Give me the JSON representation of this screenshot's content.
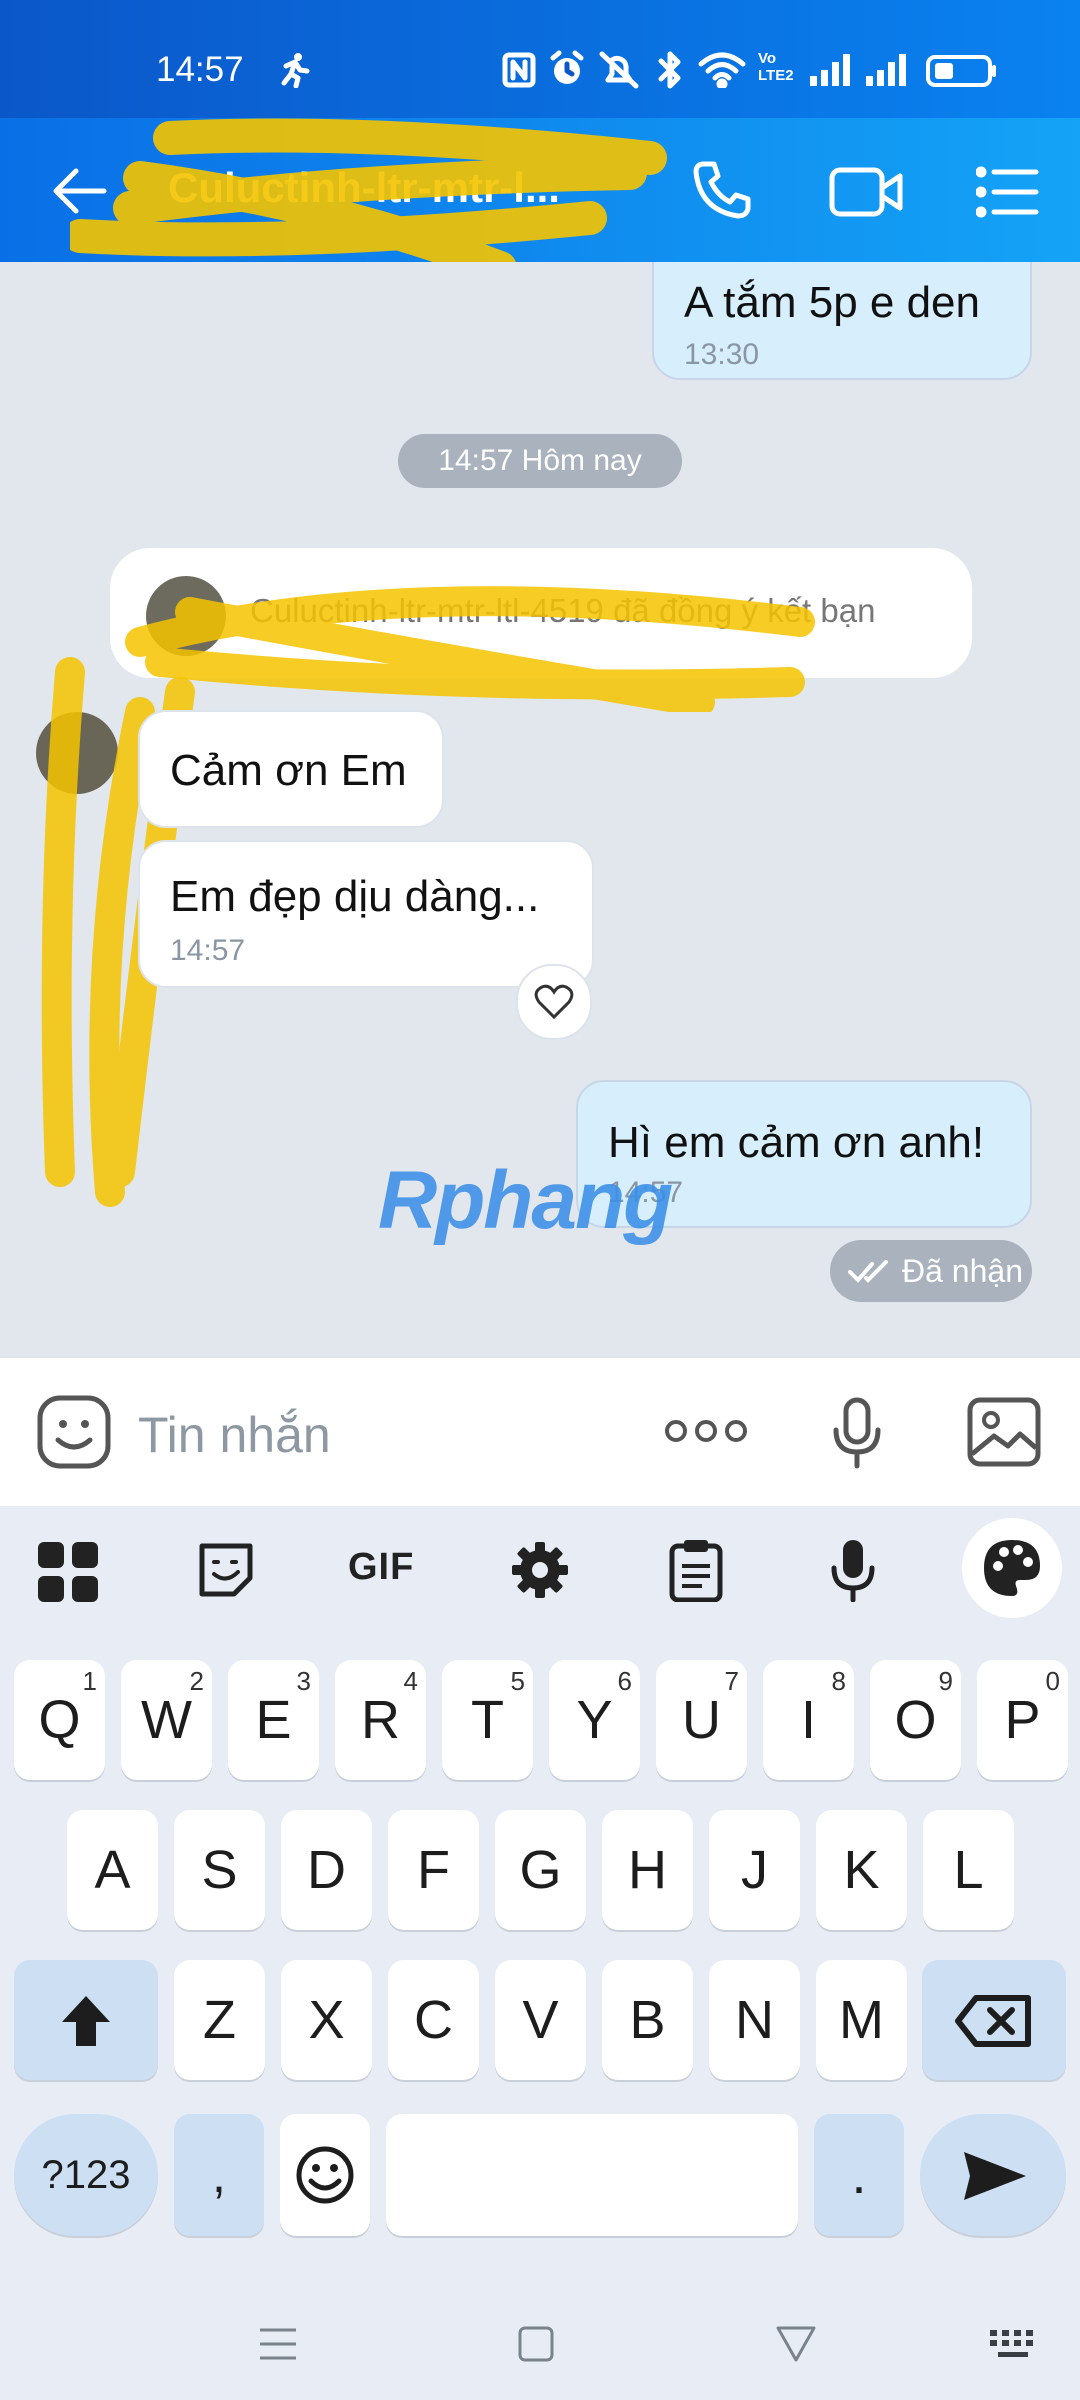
{
  "status_bar": {
    "time": "14:57"
  },
  "header": {
    "contact_name": "Culuctinh-ltr-mtr-l..."
  },
  "messages": {
    "me_1": {
      "text": "A tắm 5p e den",
      "time": "13:30"
    },
    "date_separator": "14:57 Hôm nay",
    "system_notice": "Culuctinh-ltr-mtr-ltl-4519 đã đồng ý kết bạn",
    "them_1": {
      "text": "Cảm ơn Em"
    },
    "them_2": {
      "text": "Em đẹp dịu dàng...",
      "time": "14:57"
    },
    "me_2": {
      "text": "Hì em cảm ơn anh!",
      "time": "14:57"
    },
    "delivery_status": "Đã nhận"
  },
  "watermark": "Rphang",
  "input": {
    "placeholder": "Tin nhắn"
  },
  "keyboard": {
    "toolbar": {
      "gif_label": "GIF"
    },
    "row1": [
      {
        "k": "Q",
        "n": "1"
      },
      {
        "k": "W",
        "n": "2"
      },
      {
        "k": "E",
        "n": "3"
      },
      {
        "k": "R",
        "n": "4"
      },
      {
        "k": "T",
        "n": "5"
      },
      {
        "k": "Y",
        "n": "6"
      },
      {
        "k": "U",
        "n": "7"
      },
      {
        "k": "I",
        "n": "8"
      },
      {
        "k": "O",
        "n": "9"
      },
      {
        "k": "P",
        "n": "0"
      }
    ],
    "row2": [
      "A",
      "S",
      "D",
      "F",
      "G",
      "H",
      "J",
      "K",
      "L"
    ],
    "row3": [
      "Z",
      "X",
      "C",
      "V",
      "B",
      "N",
      "M"
    ],
    "symbols_label": "?123",
    "comma": ",",
    "period": "."
  },
  "colors": {
    "header_start": "#0a6fe6",
    "header_end": "#14a3f6",
    "my_bubble": "#d7eefd",
    "chat_bg": "#e2e7ee"
  }
}
